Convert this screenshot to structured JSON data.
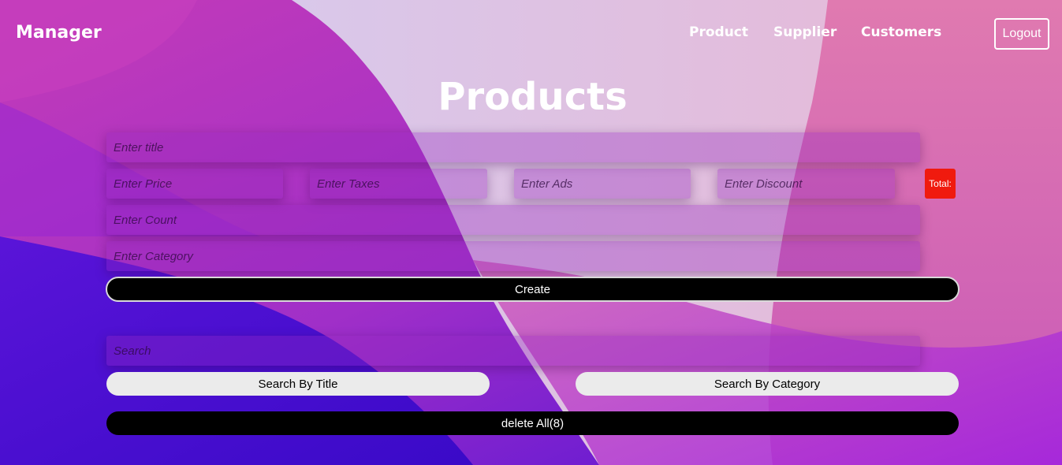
{
  "nav": {
    "brand": "Manager",
    "links": [
      "Product",
      "Supplier",
      "Customers"
    ],
    "logout_label": "Logout"
  },
  "page": {
    "title": "Products"
  },
  "form": {
    "title_placeholder": "Enter title",
    "price_placeholder": "Enter Price",
    "taxes_placeholder": "Enter Taxes",
    "ads_placeholder": "Enter Ads",
    "discount_placeholder": "Enter Discount",
    "total_label": "Total:",
    "count_placeholder": "Enter Count",
    "category_placeholder": "Enter Category",
    "create_label": "Create"
  },
  "search": {
    "placeholder": "Search",
    "by_title_label": "Search By Title",
    "by_category_label": "Search By Category",
    "delete_all_label": "delete All(8)"
  },
  "colors": {
    "total_badge": "#f01a0e",
    "create_button": "#000000",
    "search_button": "#ebebeb",
    "delete_button": "#000000"
  }
}
